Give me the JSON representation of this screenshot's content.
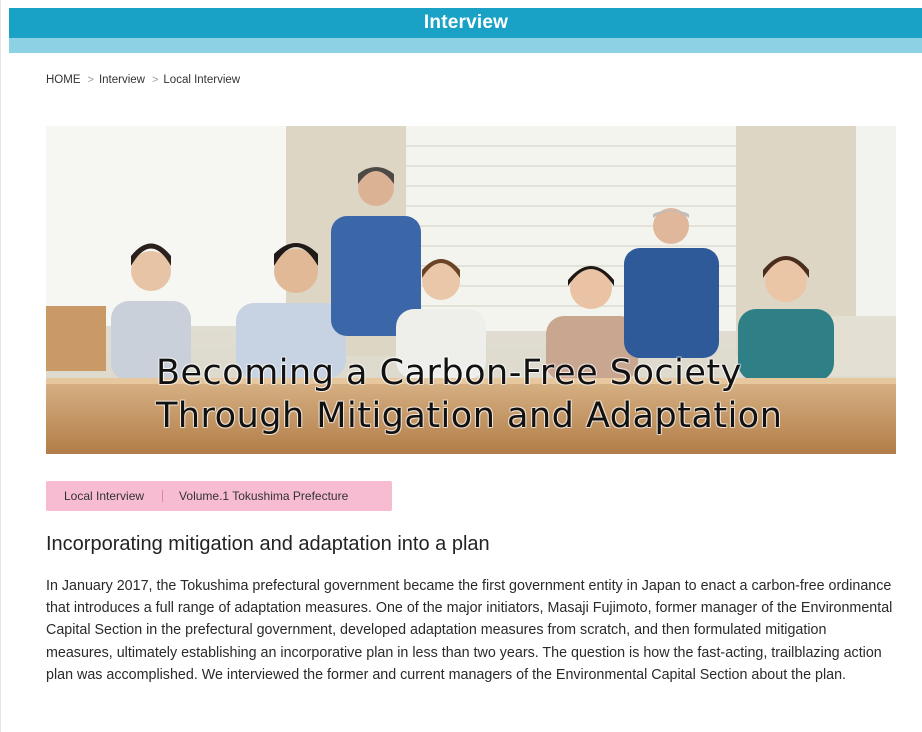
{
  "header": {
    "title": "Interview",
    "colors": {
      "bar": "#1aa2c6",
      "stripe": "#8dd1e4"
    }
  },
  "breadcrumb": {
    "items": [
      {
        "label": "HOME"
      },
      {
        "label": "Interview"
      },
      {
        "label": "Local Interview"
      }
    ],
    "separator": ">"
  },
  "hero": {
    "caption_line1": "Becoming a Carbon-Free Society",
    "caption_line2": "Through Mitigation and Adaptation",
    "image_description": "group-photo"
  },
  "tags": {
    "category": "Local Interview",
    "volume": "Volume.1 Tokushima Prefecture",
    "color": "#f7bcd1"
  },
  "article": {
    "title": "Incorporating mitigation and adaptation into a plan",
    "body": "In January 2017, the Tokushima prefectural government became the first government entity in Japan to enact a carbon-free ordinance that introduces a full range of adaptation measures. One of the major initiators, Masaji Fujimoto, former manager of the Environmental Capital Section in the prefectural government, developed adaptation measures from scratch, and then formulated mitigation measures, ultimately establishing an incorporative plan in less than two years. The question is how the fast-acting, trailblazing action plan was accomplished. We interviewed the former and current managers of the Environmental Capital Section about the plan."
  }
}
